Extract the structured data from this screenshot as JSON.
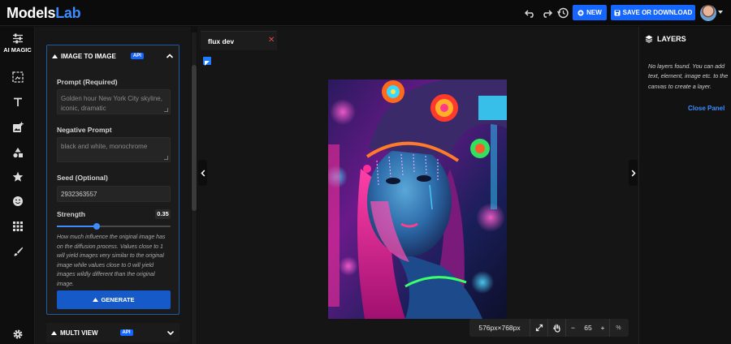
{
  "header": {
    "logo_main": "Models",
    "logo_accent": "Lab",
    "new_label": "NEW",
    "save_label": "SAVE OR DOWNLOAD"
  },
  "rail": {
    "ai_magic_label": "AI MAGIC"
  },
  "panel": {
    "title": "IMAGE TO IMAGE",
    "api_badge": "API",
    "prompt_label": "Prompt (Required)",
    "prompt_placeholder": "Golden hour New York City skyline, iconic, dramatic",
    "neg_label": "Negative Prompt",
    "neg_placeholder": "black and white, monochrome",
    "seed_label": "Seed (Optional)",
    "seed_value": "2932363557",
    "strength_label": "Strength",
    "strength_value": "0.35",
    "strength_fraction": 0.35,
    "help_text": "How much influence the original image has on the diffusion process. Values close to 1 will yield images very similar to the original image while values close to 0 will yield images wildly different than the original image.",
    "generate_label": "GENERATE"
  },
  "multi_view": {
    "title": "MULTI VIEW",
    "api_badge": "API"
  },
  "canvas": {
    "tab_label": "flux dev",
    "tab_close": "✕",
    "size_text": "576px×768px",
    "zoom_value": "65",
    "zoom_minus": "−",
    "zoom_plus": "+",
    "percent": "%"
  },
  "layers": {
    "title": "LAYERS",
    "empty_text": "No layers found. You can add text, element, image etc. to the canvas to create a layer.",
    "close_label": "Close Panel"
  },
  "colors": {
    "accent": "#1565ff",
    "link": "#3d8bff",
    "close_x": "#e04848"
  }
}
